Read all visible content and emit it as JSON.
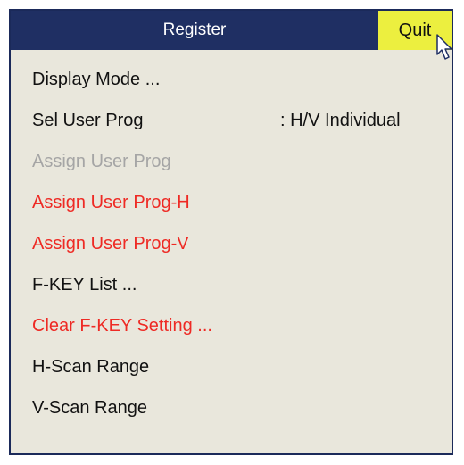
{
  "window": {
    "title": "Register",
    "quit_label": "Quit"
  },
  "colors": {
    "title_bar": "#1f2f63",
    "quit_button": "#ecef3f",
    "panel_background": "#e9e7dc",
    "text_normal": "#111111",
    "text_disabled": "#a5a5a5",
    "text_red": "#ee2a24"
  },
  "icons": {
    "cursor": "mouse-pointer-icon"
  },
  "menu": {
    "items": [
      {
        "label": "Display Mode ...",
        "state": "normal"
      },
      {
        "label": "Sel User Prog",
        "value": ": H/V Individual",
        "state": "normal"
      },
      {
        "label": "Assign User Prog",
        "state": "disabled"
      },
      {
        "label": "Assign User Prog-H",
        "state": "red"
      },
      {
        "label": "Assign User Prog-V",
        "state": "red"
      },
      {
        "label": "F-KEY List ...",
        "state": "normal"
      },
      {
        "label": "Clear F-KEY Setting ...",
        "state": "red"
      },
      {
        "label": "H-Scan Range",
        "state": "normal"
      },
      {
        "label": "V-Scan Range",
        "state": "normal"
      }
    ]
  }
}
